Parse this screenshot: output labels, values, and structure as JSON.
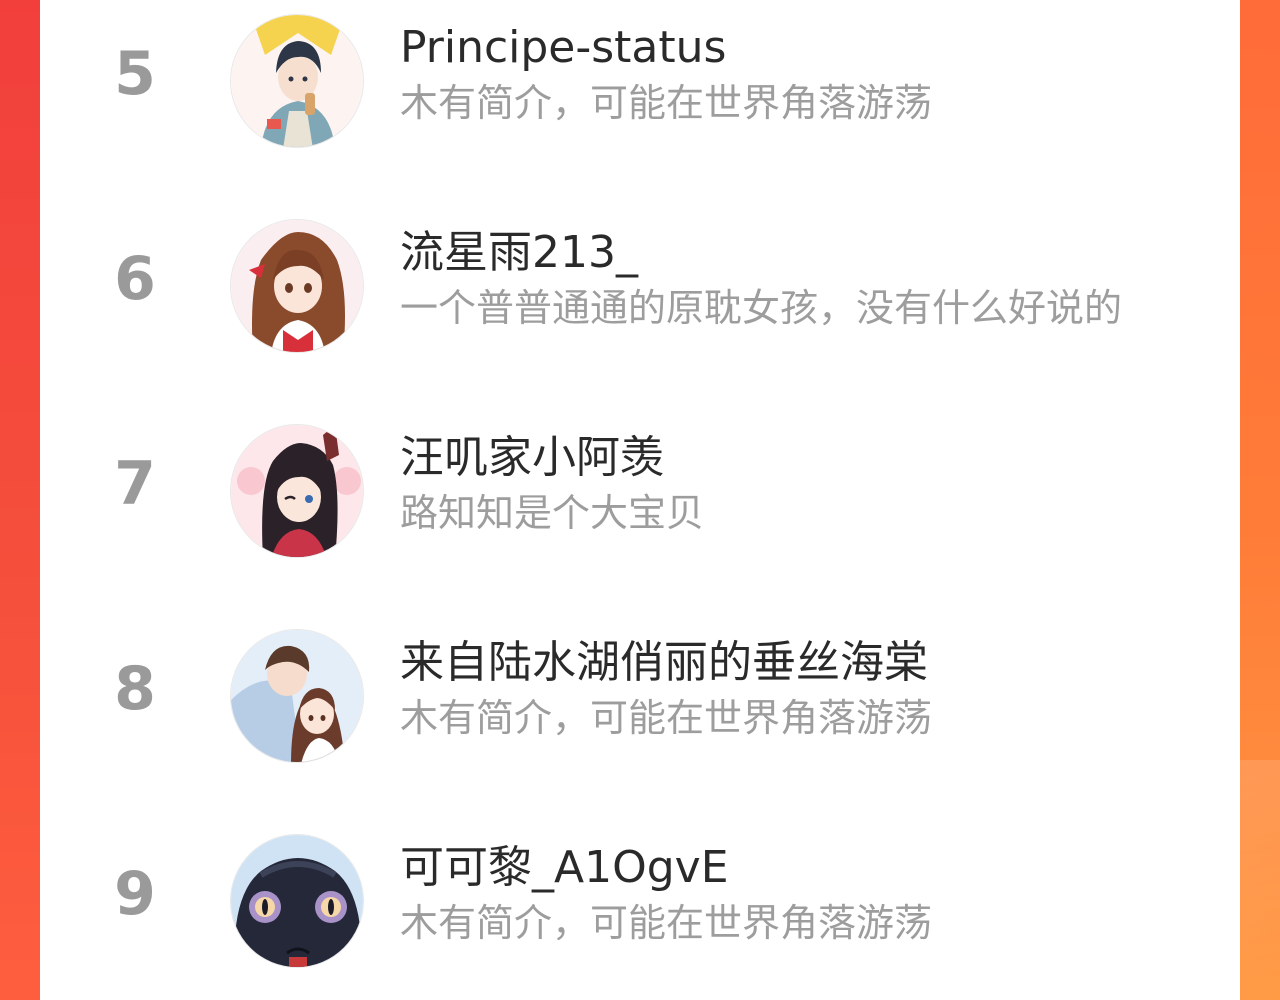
{
  "colors": {
    "rank": "#9a9a9a",
    "name": "#2a2a2a",
    "bio": "#9d9d9d",
    "card_background": "#ffffff",
    "side_gradient_left": "#f23f3c",
    "side_gradient_right": "#ff8a3c"
  },
  "ranking": {
    "entries": [
      {
        "rank": "5",
        "name": "Principe-status",
        "bio": "木有简介，可能在世界角落游荡",
        "avatar": "anime-boy-avatar-icon"
      },
      {
        "rank": "6",
        "name": "流星雨213_",
        "bio": "一个普普通通的原耽女孩，没有什么好说的",
        "avatar": "anime-girl-brown-hair-avatar-icon"
      },
      {
        "rank": "7",
        "name": "汪叽家小阿羡",
        "bio": "路知知是个大宝贝",
        "avatar": "anime-boy-winking-avatar-icon"
      },
      {
        "rank": "8",
        "name": "来自陆水湖俏丽的垂丝海棠",
        "bio": "木有简介，可能在世界角落游荡",
        "avatar": "anime-couple-avatar-icon"
      },
      {
        "rank": "9",
        "name": "可可黎_A1OgvE",
        "bio": "木有简介，可能在世界角落游荡",
        "avatar": "dark-creature-avatar-icon"
      }
    ]
  }
}
